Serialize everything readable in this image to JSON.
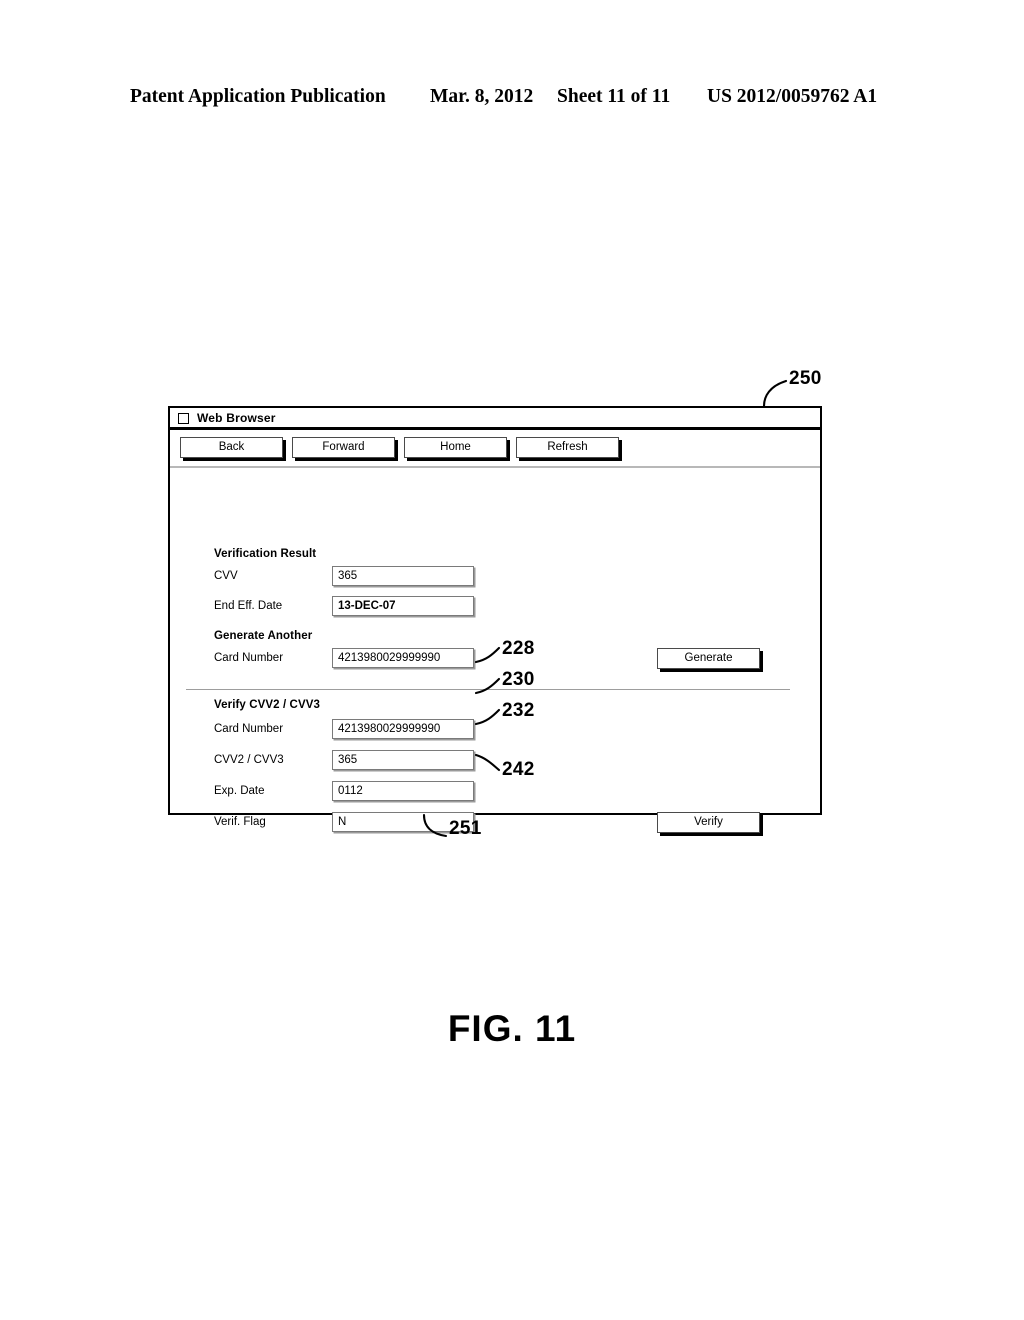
{
  "page_header": {
    "publication": "Patent Application Publication",
    "date": "Mar. 8, 2012",
    "sheet": "Sheet 11 of 11",
    "patent_number": "US 2012/0059762 A1"
  },
  "figure": {
    "caption": "FIG. 11"
  },
  "browser": {
    "title": "Web Browser",
    "title_icon": "square-checkbox-icon",
    "toolbar_buttons": [
      {
        "label": "Back"
      },
      {
        "label": "Forward"
      },
      {
        "label": "Home"
      },
      {
        "label": "Refresh"
      }
    ]
  },
  "verification_result": {
    "heading": "Verification Result",
    "fields": [
      {
        "label": "CVV",
        "value": "365",
        "bold": false
      },
      {
        "label": "End Eff. Date",
        "value": "13-DEC-07",
        "bold": true
      }
    ]
  },
  "generate_another": {
    "heading": "Generate Another",
    "fields": [
      {
        "label": "Card Number",
        "value": "4213980029999990"
      }
    ],
    "button_label": "Generate"
  },
  "verify_cvv": {
    "heading": "Verify CVV2 / CVV3",
    "fields": [
      {
        "label": "Card Number",
        "value": "4213980029999990"
      },
      {
        "label": "CVV2 / CVV3",
        "value": "365"
      },
      {
        "label": "Exp. Date",
        "value": "0112"
      },
      {
        "label": "Verif. Flag",
        "value": "N"
      }
    ],
    "button_label": "Verify"
  },
  "reference_numerals": [
    {
      "id": "250",
      "target": "browser-window-frame"
    },
    {
      "id": "251",
      "target": "browser-window-bottom"
    },
    {
      "id": "228",
      "target": "verify-card-number-field"
    },
    {
      "id": "230",
      "target": "verify-cvv-field"
    },
    {
      "id": "232",
      "target": "verify-exp-date-field"
    },
    {
      "id": "242",
      "target": "verify-flag-field"
    }
  ],
  "colors": {
    "ink": "#000000",
    "paper": "#ffffff",
    "field_border": "#7a7a7a",
    "divider": "#9d9d9d"
  }
}
